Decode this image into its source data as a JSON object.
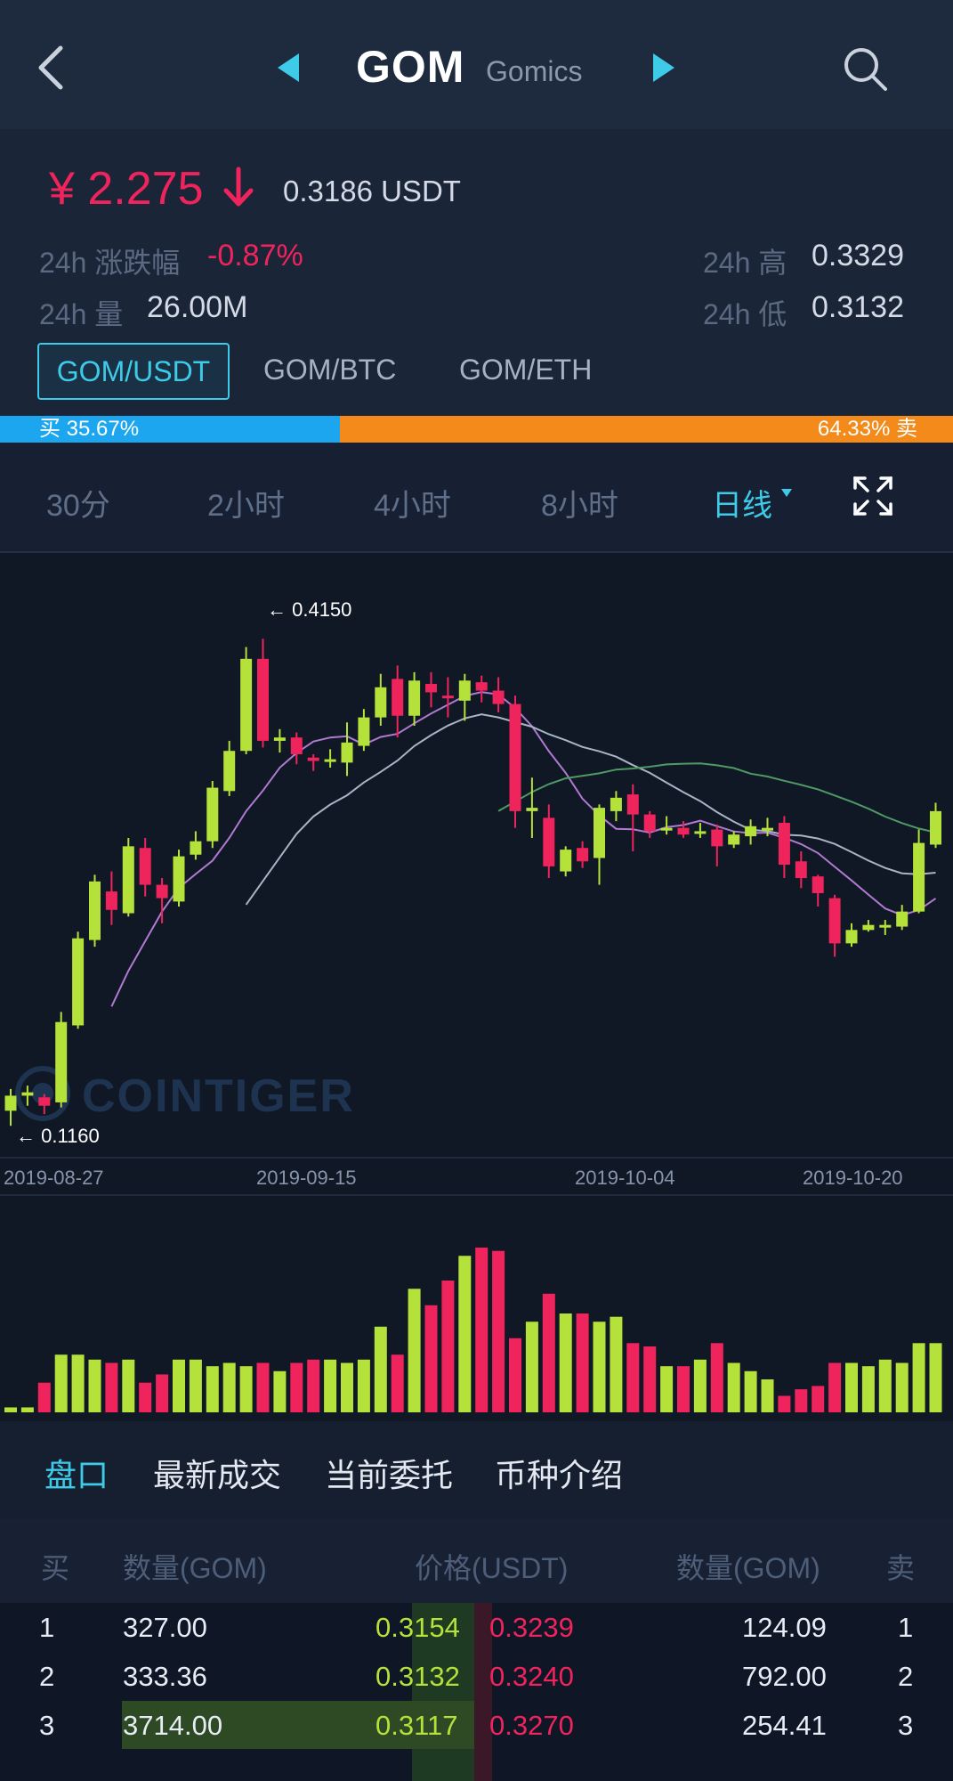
{
  "header": {
    "symbol": "GOM",
    "name": "Gomics"
  },
  "ticker": {
    "price_cny": "¥ 2.275",
    "price_usdt": "0.3186 USDT",
    "change_label": "24h 涨跌幅",
    "change_value": "-0.87%",
    "volume_label": "24h 量",
    "volume_value": "26.00M",
    "high_label": "24h 高",
    "high_value": "0.3329",
    "low_label": "24h 低",
    "low_value": "0.3132"
  },
  "pairs": [
    "GOM/USDT",
    "GOM/BTC",
    "GOM/ETH"
  ],
  "ratio": {
    "buy_label": "买 35.67%",
    "sell_label": "64.33% 卖",
    "buy_fraction": 0.3567
  },
  "timeframes": [
    "30分",
    "2小时",
    "4小时",
    "8小时",
    "日线"
  ],
  "active_timeframe": "日线",
  "chart": {
    "watermark": "COINTIGER",
    "max_label": "← 0.4150",
    "min_label": "← 0.1160"
  },
  "chart_data": {
    "type": "candlestick",
    "xlabels": [
      "2019-08-27",
      "2019-09-15",
      "2019-10-04",
      "2019-10-20"
    ],
    "max_marker": 0.415,
    "min_marker": 0.116,
    "candles": [
      [
        0.127,
        0.136,
        0.118,
        0.14
      ],
      [
        0.136,
        0.138,
        0.13,
        0.142
      ],
      [
        0.135,
        0.13,
        0.125,
        0.137
      ],
      [
        0.132,
        0.18,
        0.129,
        0.186
      ],
      [
        0.178,
        0.23,
        0.176,
        0.234
      ],
      [
        0.229,
        0.264,
        0.225,
        0.268
      ],
      [
        0.258,
        0.247,
        0.238,
        0.27
      ],
      [
        0.245,
        0.285,
        0.243,
        0.29
      ],
      [
        0.284,
        0.262,
        0.255,
        0.29
      ],
      [
        0.262,
        0.254,
        0.239,
        0.266
      ],
      [
        0.252,
        0.279,
        0.249,
        0.283
      ],
      [
        0.28,
        0.288,
        0.277,
        0.294
      ],
      [
        0.288,
        0.32,
        0.284,
        0.324
      ],
      [
        0.318,
        0.342,
        0.315,
        0.348
      ],
      [
        0.342,
        0.397,
        0.34,
        0.404
      ],
      [
        0.397,
        0.348,
        0.344,
        0.409
      ],
      [
        0.348,
        0.35,
        0.341,
        0.355
      ],
      [
        0.35,
        0.34,
        0.334,
        0.353
      ],
      [
        0.338,
        0.336,
        0.33,
        0.34
      ],
      [
        0.336,
        0.337,
        0.332,
        0.343
      ],
      [
        0.335,
        0.347,
        0.327,
        0.359
      ],
      [
        0.345,
        0.362,
        0.342,
        0.367
      ],
      [
        0.362,
        0.38,
        0.357,
        0.388
      ],
      [
        0.385,
        0.363,
        0.35,
        0.393
      ],
      [
        0.363,
        0.384,
        0.357,
        0.389
      ],
      [
        0.382,
        0.377,
        0.368,
        0.389
      ],
      [
        0.375,
        0.374,
        0.362,
        0.386
      ],
      [
        0.372,
        0.384,
        0.36,
        0.388
      ],
      [
        0.383,
        0.378,
        0.371,
        0.387
      ],
      [
        0.378,
        0.37,
        0.365,
        0.386
      ],
      [
        0.37,
        0.306,
        0.296,
        0.375
      ],
      [
        0.306,
        0.308,
        0.29,
        0.326
      ],
      [
        0.302,
        0.273,
        0.266,
        0.31
      ],
      [
        0.27,
        0.283,
        0.267,
        0.285
      ],
      [
        0.284,
        0.276,
        0.272,
        0.288
      ],
      [
        0.278,
        0.308,
        0.262,
        0.31
      ],
      [
        0.306,
        0.314,
        0.3,
        0.318
      ],
      [
        0.316,
        0.304,
        0.282,
        0.322
      ],
      [
        0.304,
        0.294,
        0.29,
        0.306
      ],
      [
        0.296,
        0.296,
        0.292,
        0.303
      ],
      [
        0.296,
        0.292,
        0.29,
        0.3
      ],
      [
        0.294,
        0.294,
        0.29,
        0.299
      ],
      [
        0.295,
        0.285,
        0.273,
        0.298
      ],
      [
        0.286,
        0.292,
        0.284,
        0.294
      ],
      [
        0.291,
        0.297,
        0.286,
        0.301
      ],
      [
        0.296,
        0.296,
        0.291,
        0.302
      ],
      [
        0.299,
        0.274,
        0.266,
        0.303
      ],
      [
        0.276,
        0.266,
        0.26,
        0.282
      ],
      [
        0.267,
        0.257,
        0.249,
        0.268
      ],
      [
        0.254,
        0.227,
        0.219,
        0.256
      ],
      [
        0.227,
        0.235,
        0.225,
        0.239
      ],
      [
        0.235,
        0.238,
        0.234,
        0.241
      ],
      [
        0.238,
        0.238,
        0.232,
        0.241
      ],
      [
        0.237,
        0.246,
        0.235,
        0.25
      ],
      [
        0.246,
        0.287,
        0.245,
        0.295
      ],
      [
        0.286,
        0.306,
        0.284,
        0.311
      ]
    ],
    "volumes": [
      3,
      3,
      18,
      35,
      35,
      32,
      30,
      32,
      18,
      23,
      32,
      32,
      28,
      30,
      28,
      30,
      25,
      30,
      32,
      32,
      30,
      32,
      52,
      35,
      75,
      65,
      80,
      95,
      100,
      98,
      45,
      55,
      72,
      60,
      60,
      55,
      58,
      42,
      40,
      28,
      28,
      32,
      42,
      30,
      25,
      20,
      10,
      14,
      16,
      30,
      30,
      28,
      32,
      30,
      42,
      42
    ]
  },
  "tabs": [
    "盘口",
    "最新成交",
    "当前委托",
    "币种介绍"
  ],
  "orderbook": {
    "headers": {
      "buy": "买",
      "qty_left": "数量(GOM)",
      "price": "价格(USDT)",
      "qty_right": "数量(GOM)",
      "sell": "卖"
    },
    "rows": [
      {
        "idx": "1",
        "bid_qty": "327.00",
        "bid_price": "0.3154",
        "ask_price": "0.3239",
        "ask_qty": "124.09",
        "idx_r": "1"
      },
      {
        "idx": "2",
        "bid_qty": "333.36",
        "bid_price": "0.3132",
        "ask_price": "0.3240",
        "ask_qty": "792.00",
        "idx_r": "2"
      },
      {
        "idx": "3",
        "bid_qty": "3714.00",
        "bid_price": "0.3117",
        "ask_price": "0.3270",
        "ask_qty": "254.41",
        "idx_r": "3"
      }
    ]
  },
  "colors": {
    "up": "#b4e13a",
    "down": "#f0245c",
    "accent": "#3ecbe8",
    "buy_bar": "#1da6f0",
    "sell_bar": "#f38a1a"
  }
}
